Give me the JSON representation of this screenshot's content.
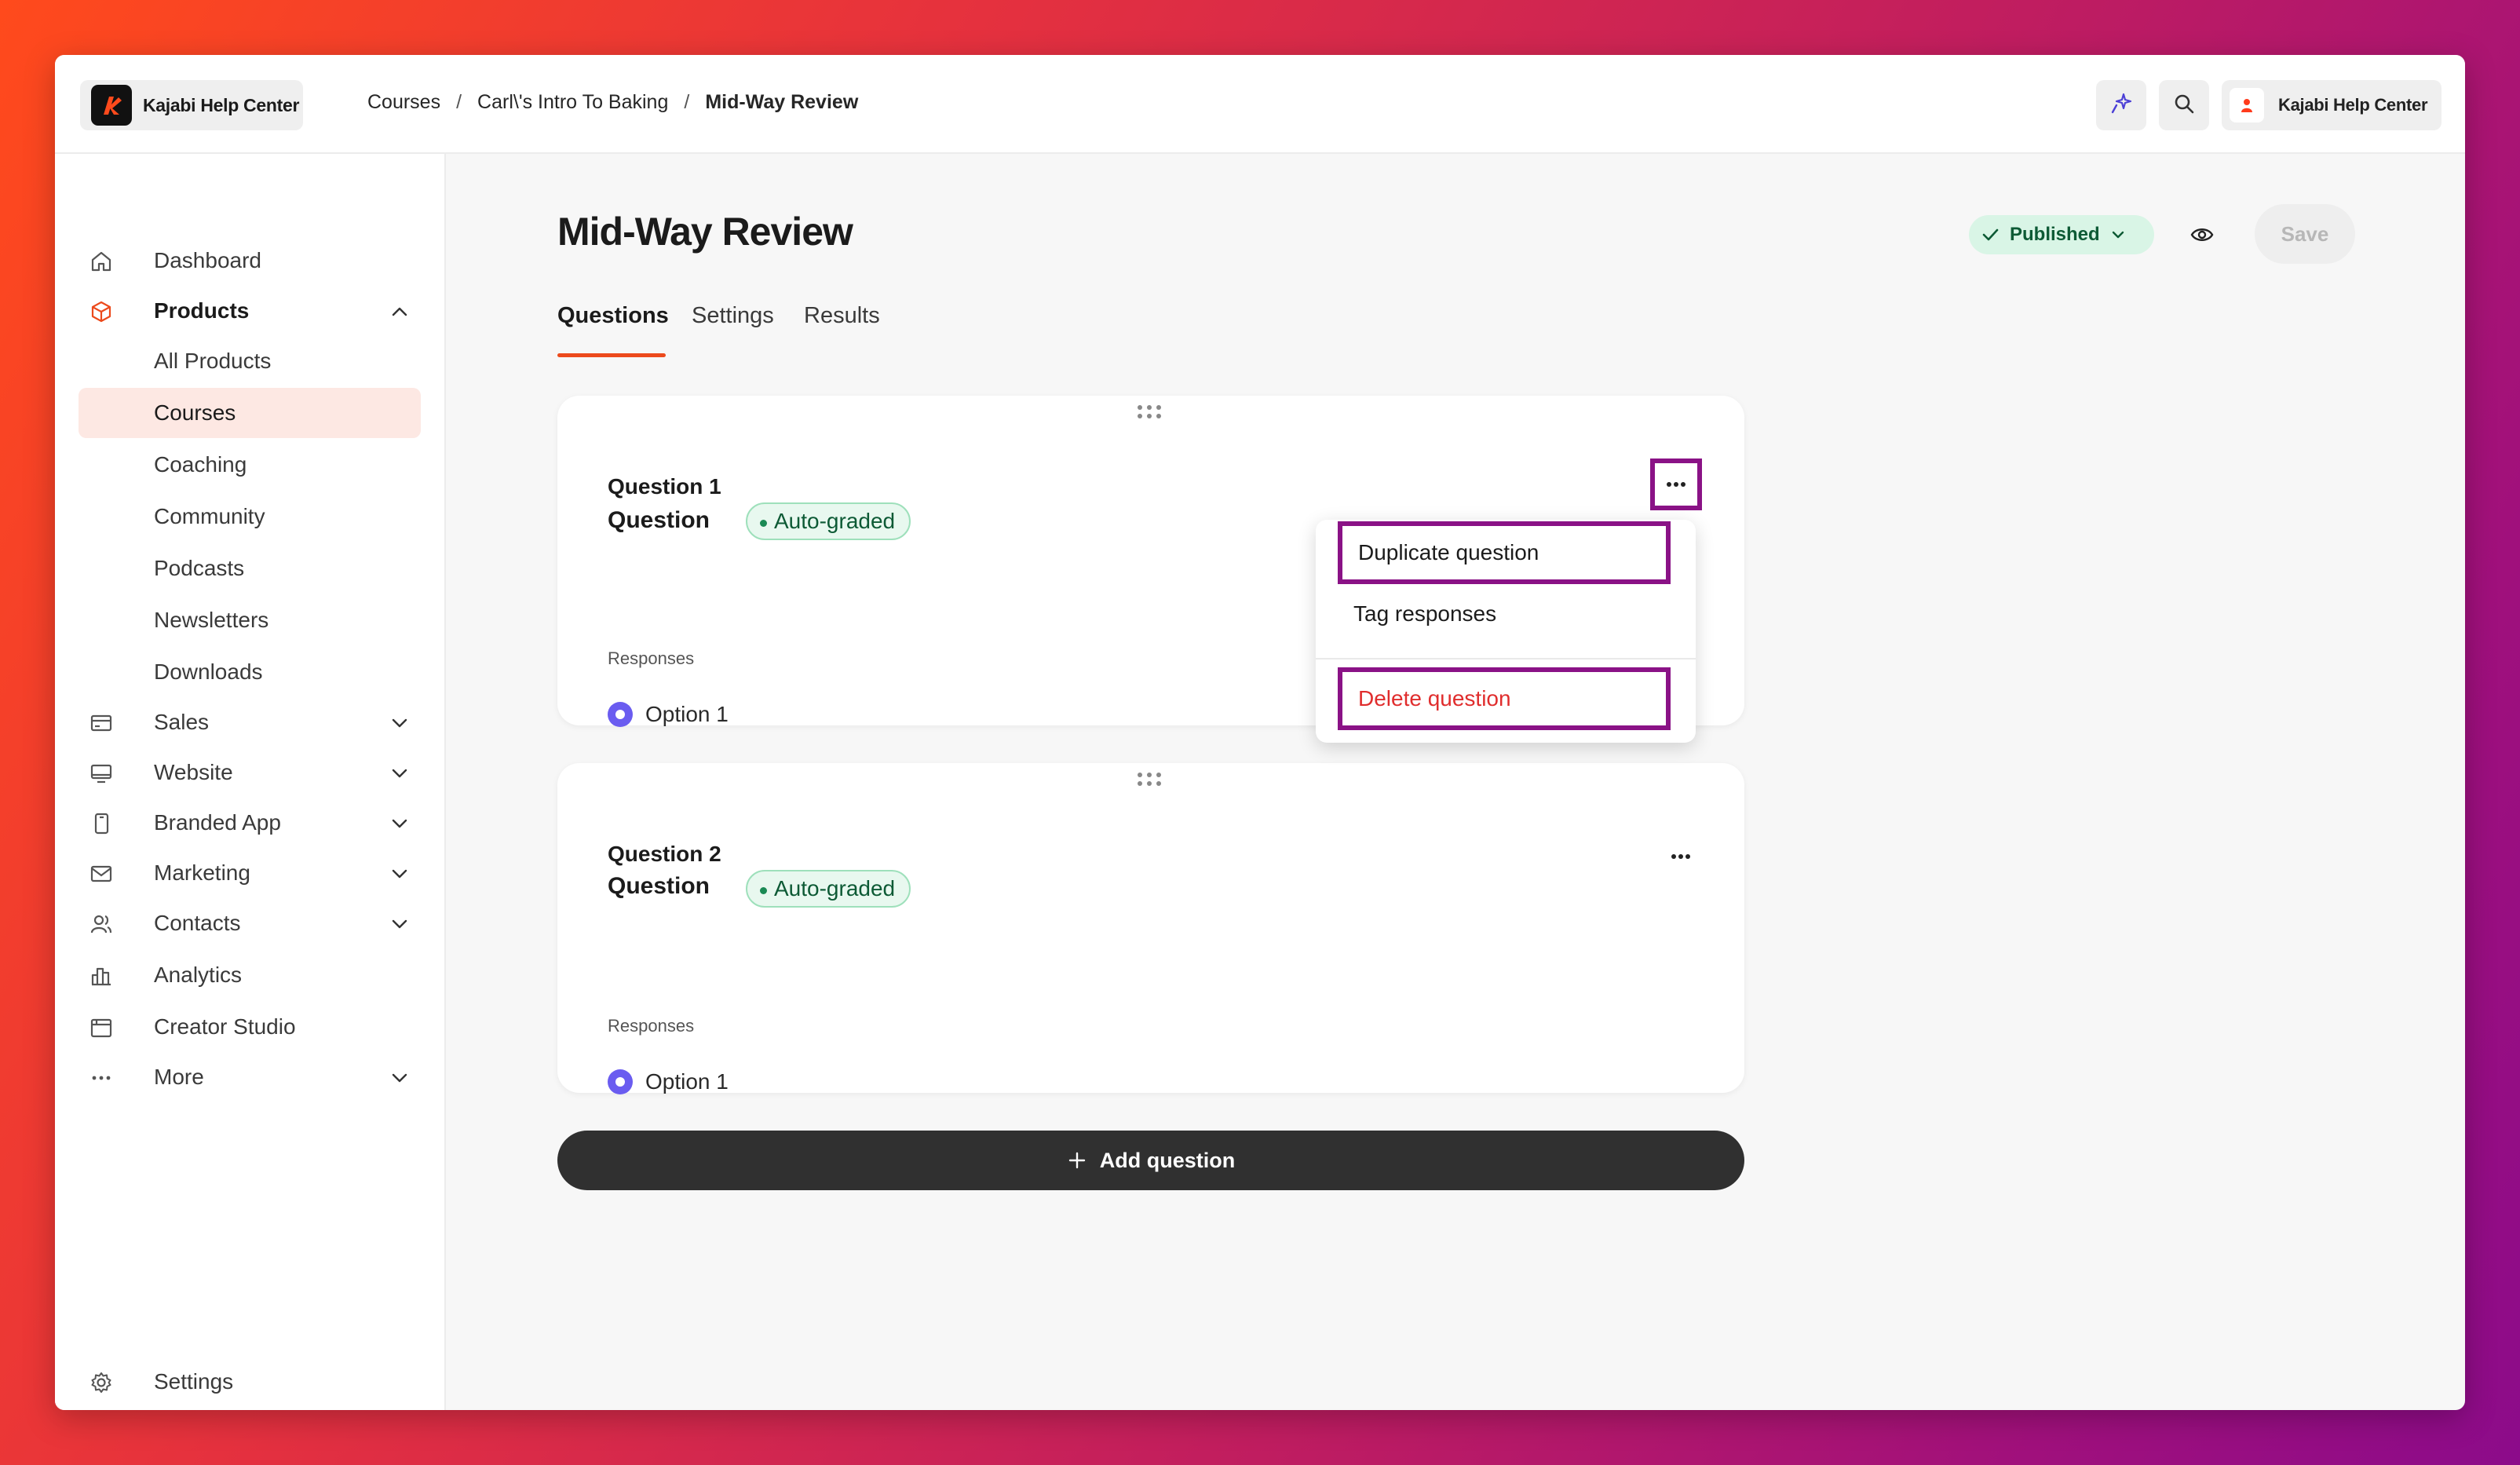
{
  "topbar": {
    "brand_name": "Kajabi Help Center",
    "breadcrumbs": [
      "Courses",
      "Carl\\'s Intro To Baking",
      "Mid-Way Review"
    ],
    "separator": "/",
    "account_name": "Kajabi Help Center"
  },
  "sidebar": {
    "items": [
      {
        "label": "Dashboard",
        "icon": "home-icon"
      },
      {
        "label": "Products",
        "icon": "box-icon",
        "expanded": true
      },
      {
        "label": "Sales",
        "icon": "card-icon"
      },
      {
        "label": "Website",
        "icon": "monitor-icon"
      },
      {
        "label": "Branded App",
        "icon": "phone-icon"
      },
      {
        "label": "Marketing",
        "icon": "mail-icon"
      },
      {
        "label": "Contacts",
        "icon": "contacts-icon"
      },
      {
        "label": "Analytics",
        "icon": "analytics-icon"
      },
      {
        "label": "Creator Studio",
        "icon": "calendar-icon"
      },
      {
        "label": "More",
        "icon": "more-icon"
      }
    ],
    "product_subitems": [
      "All Products",
      "Courses",
      "Coaching",
      "Community",
      "Podcasts",
      "Newsletters",
      "Downloads"
    ],
    "active_subitem": "Courses",
    "settings_label": "Settings"
  },
  "main": {
    "title": "Mid-Way Review",
    "status": "Published",
    "save_label": "Save",
    "tabs": [
      "Questions",
      "Settings",
      "Results"
    ],
    "active_tab": "Questions",
    "questions": [
      {
        "number": "Question 1",
        "text": "Question",
        "badge": "Auto-graded",
        "responses_label": "Responses",
        "option": "Option 1"
      },
      {
        "number": "Question 2",
        "text": "Question",
        "badge": "Auto-graded",
        "responses_label": "Responses",
        "option": "Option 1"
      }
    ],
    "menu": {
      "duplicate": "Duplicate question",
      "tag": "Tag responses",
      "delete": "Delete question"
    },
    "add_question_label": "Add question"
  },
  "colors": {
    "accent": "#ec4a1c",
    "highlight_border": "#8a1286",
    "published_bg": "#d9f5e6",
    "danger": "#e02d2d",
    "radio": "#6a5cf0"
  }
}
